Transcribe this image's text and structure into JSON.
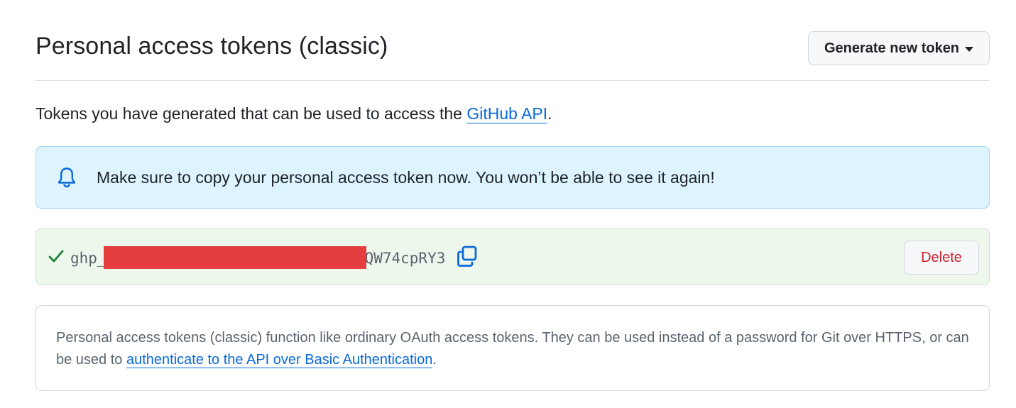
{
  "header": {
    "title": "Personal access tokens (classic)",
    "generate_button": "Generate new token"
  },
  "intro": {
    "text_before": "Tokens you have generated that can be used to access the ",
    "link": "GitHub API",
    "text_after": "."
  },
  "flash": {
    "icon": "bell-icon",
    "message": "Make sure to copy your personal access token now. You won’t be able to see it again!"
  },
  "token": {
    "prefix": "ghp_",
    "suffix": "QW74cpRY3",
    "delete_label": "Delete"
  },
  "info": {
    "text_before": "Personal access tokens (classic) function like ordinary OAuth access tokens. They can be used instead of a password for Git over HTTPS, or can be used to ",
    "link": "authenticate to the API over Basic Authentication",
    "text_after": "."
  },
  "colors": {
    "accent": "#0969da",
    "danger": "#cf222e",
    "success": "#1a7f37",
    "redaction": "#e53e3e"
  }
}
